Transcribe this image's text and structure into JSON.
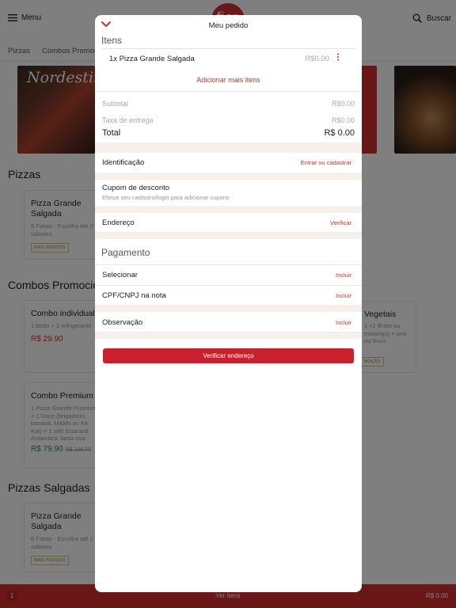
{
  "header": {
    "menu_label": "Menu",
    "logo_text": "fica",
    "search_label": "Buscar"
  },
  "categories": [
    "Pizzas",
    "Combos Promoc"
  ],
  "banner": {
    "text": "Nordestin"
  },
  "sections": {
    "pizzas": "Pizzas",
    "combos": "Combos Promocio",
    "salgadas": "Pizzas Salgadas"
  },
  "cards": [
    {
      "name": "Pizza Grande Salgada",
      "desc": "8 Fatias - Escolha até 2 sabores",
      "badge": "MAIS PEDIDOS"
    },
    {
      "name": "Combo individual",
      "desc": "1 broto + 1 refrigerante",
      "price": "R$ 29.90"
    },
    {
      "name": "Combo Premium",
      "desc": "1 Pizza Grande Premium + 1 Doce (brigadeiro, banana, M&Ms ou Kit Kat) + 1 refri Guaraná Antarctica, fanta uva, Coca Cola ou Suco",
      "price": "R$ 79.90",
      "old_price": "R$ 106.70"
    },
    {
      "name": "Pizza Grande Salgada",
      "desc": "8 Fatias - Escolha até 2 sabores",
      "badge": "MAIS PEDIDOS"
    },
    {
      "name": "Vegetais",
      "desc": "1 +1 Broto ou morango) + aná ou Suco",
      "badge": "MOÇÃO"
    }
  ],
  "bottombar": {
    "count": "1",
    "label": "Ver itens",
    "total": "R$ 0.00"
  },
  "modal": {
    "title": "Meu pedido",
    "itens_title": "Itens",
    "item": {
      "name": "1x Pizza Grande Salgada",
      "price": "R$0.00"
    },
    "add_more": "Adicionar mais itens",
    "subtotal_label": "Subtotal",
    "subtotal_value": "R$0.00",
    "taxa_label": "Taxa de entrega",
    "taxa_value": "R$0.00",
    "total_label": "Total",
    "total_value": "R$ 0.00",
    "identificacao_label": "Identificação",
    "identificacao_action": "Entrar ou cadastrar",
    "cupom_label": "Cupom de desconto",
    "cupom_sub": "Efetue seu cadastro/login para adicionar cupons",
    "endereco_label": "Endereço",
    "endereco_action": "Verificar",
    "pagamento_title": "Pagamento",
    "selecionar_label": "Selecionar",
    "selecionar_action": "Incluir",
    "cpf_label": "CPF/CNPJ na nota",
    "cpf_action": "Incluir",
    "observacao_label": "Observação",
    "observacao_action": "Incluir",
    "verify_button": "Verificar endereço"
  },
  "colors": {
    "brand_red": "#d32f2f",
    "button_red": "#c8202d",
    "section_gap": "#f5f0eb"
  }
}
